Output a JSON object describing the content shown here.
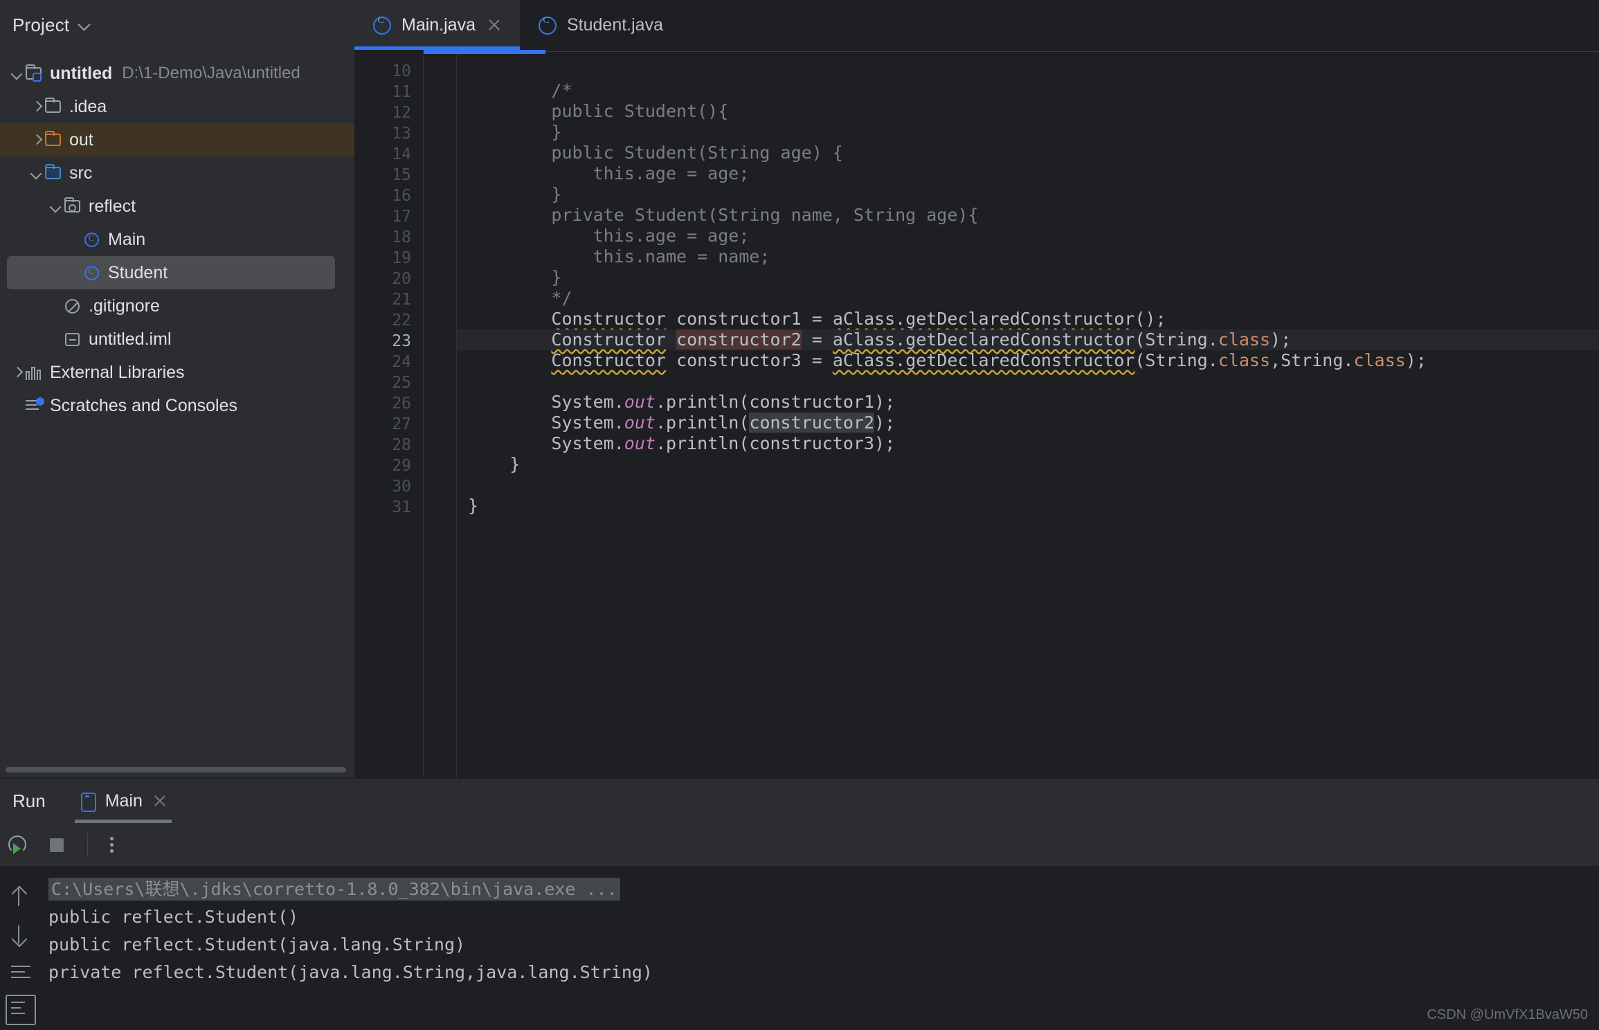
{
  "sidebar": {
    "title": "Project",
    "chevron_icon": "chevron-down-icon",
    "tree": [
      {
        "label": "untitled",
        "path": "D:\\1-Demo\\Java\\untitled",
        "icon": "project-folder-icon",
        "arrow": "open",
        "indent": 0,
        "bold": true,
        "state": "normal"
      },
      {
        "label": ".idea",
        "path": "",
        "icon": "folder-icon",
        "arrow": "closed",
        "indent": 1,
        "bold": false,
        "state": "normal"
      },
      {
        "label": "out",
        "path": "",
        "icon": "folder-orange-icon",
        "arrow": "closed",
        "indent": 1,
        "bold": false,
        "state": "highlighted"
      },
      {
        "label": "src",
        "path": "",
        "icon": "folder-source-icon",
        "arrow": "open",
        "indent": 1,
        "bold": false,
        "state": "normal"
      },
      {
        "label": "reflect",
        "path": "",
        "icon": "package-folder-icon",
        "arrow": "open",
        "indent": 2,
        "bold": false,
        "state": "normal"
      },
      {
        "label": "Main",
        "path": "",
        "icon": "java-class-icon",
        "arrow": "none",
        "indent": 3,
        "bold": false,
        "state": "normal"
      },
      {
        "label": "Student",
        "path": "",
        "icon": "java-class-icon",
        "arrow": "none",
        "indent": 3,
        "bold": false,
        "state": "selected"
      },
      {
        "label": ".gitignore",
        "path": "",
        "icon": "gitignore-icon",
        "arrow": "none",
        "indent": 2,
        "bold": false,
        "state": "normal"
      },
      {
        "label": "untitled.iml",
        "path": "",
        "icon": "iml-module-icon",
        "arrow": "none",
        "indent": 2,
        "bold": false,
        "state": "normal"
      },
      {
        "label": "External Libraries",
        "path": "",
        "icon": "libraries-icon",
        "arrow": "closed",
        "indent": 0,
        "bold": false,
        "state": "normal"
      },
      {
        "label": "Scratches and Consoles",
        "path": "",
        "icon": "scratches-icon",
        "arrow": "none",
        "indent": 0,
        "bold": false,
        "state": "normal"
      }
    ]
  },
  "editor": {
    "tabs": [
      {
        "label": "Main.java",
        "icon": "java-class-icon",
        "active": true,
        "closable": true
      },
      {
        "label": "Student.java",
        "icon": "java-class-icon",
        "active": false,
        "closable": false
      }
    ],
    "current_line": 23,
    "lines": [
      {
        "n": 10,
        "text": ""
      },
      {
        "n": 11,
        "text": "        /*"
      },
      {
        "n": 12,
        "text": "        public Student(){"
      },
      {
        "n": 13,
        "text": "        }"
      },
      {
        "n": 14,
        "text": "        public Student(String age) {"
      },
      {
        "n": 15,
        "text": "            this.age = age;"
      },
      {
        "n": 16,
        "text": "        }"
      },
      {
        "n": 17,
        "text": "        private Student(String name, String age){"
      },
      {
        "n": 18,
        "text": "            this.age = age;"
      },
      {
        "n": 19,
        "text": "            this.name = name;"
      },
      {
        "n": 20,
        "text": "        }"
      },
      {
        "n": 21,
        "text": "        */"
      },
      {
        "n": 22,
        "text": "        Constructor constructor1 = aClass.getDeclaredConstructor();"
      },
      {
        "n": 23,
        "text": "        Constructor constructor2 = aClass.getDeclaredConstructor(String.class);"
      },
      {
        "n": 24,
        "text": "        Constructor constructor3 = aClass.getDeclaredConstructor(String.class,String.class);"
      },
      {
        "n": 25,
        "text": ""
      },
      {
        "n": 26,
        "text": "        System.out.println(constructor1);"
      },
      {
        "n": 27,
        "text": "        System.out.println(constructor2);"
      },
      {
        "n": 28,
        "text": "        System.out.println(constructor3);"
      },
      {
        "n": 29,
        "text": "    }"
      },
      {
        "n": 30,
        "text": ""
      },
      {
        "n": 31,
        "text": "}"
      }
    ]
  },
  "run_panel": {
    "title": "Run",
    "tab_label": "Main",
    "tab_icon": "run-config-icon",
    "tab_close_icon": "close-icon",
    "toolbar": {
      "rerun_icon": "rerun-icon",
      "stop_icon": "stop-icon",
      "more_icon": "kebab-menu-icon"
    },
    "gutter_icons": [
      "scroll-up-icon",
      "scroll-down-icon",
      "wrap-text-icon",
      "soft-wrap-icon"
    ],
    "console": [
      {
        "text": "C:\\Users\\联想\\.jdks\\corretto-1.8.0_382\\bin\\java.exe ...",
        "style": "command"
      },
      {
        "text": "public reflect.Student()",
        "style": "normal"
      },
      {
        "text": "public reflect.Student(java.lang.String)",
        "style": "normal"
      },
      {
        "text": "private reflect.Student(java.lang.String,java.lang.String)",
        "style": "normal"
      }
    ]
  },
  "watermark": "CSDN @UmVfX1BvaW50",
  "colors": {
    "accent": "#3574f0",
    "sidebar_bg": "#2b2d30",
    "editor_bg": "#1e1f22",
    "keyword": "#cf8e6d",
    "field_italic": "#c77dbb",
    "warn_wave": "#c8a438",
    "selection_red": "#4e3434",
    "highlight_grey": "#3a3d42"
  }
}
